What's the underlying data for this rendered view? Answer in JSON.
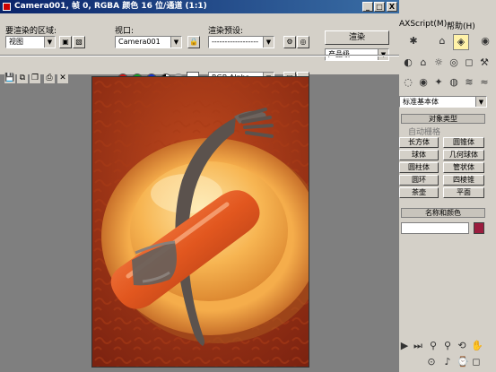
{
  "window": {
    "title": "Camera001, 帧 0, RGBA 颜色 16 位/通道 (1:1)",
    "minimize": "_",
    "maximize": "□",
    "close": "X"
  },
  "controls": {
    "area_label": "要渲染的区域:",
    "area_value": "视图",
    "viewport_label": "视口:",
    "viewport_value": "Camera001",
    "preset_label": "渲染预设:",
    "preset_value": "------------------",
    "render_button": "渲染",
    "quality_value": "产品级",
    "channel_value": "RGB Alpha",
    "dropdown_arrow": "▼"
  },
  "menu": {
    "maxscript": "AXScript(M)",
    "help": "帮助(H)"
  },
  "command_panel": {
    "category": "标准基本体",
    "rollout_title": "对象类型",
    "autogrid": "自动栅格",
    "buttons": [
      "长方体",
      "圆锥体",
      "球体",
      "几何球体",
      "圆柱体",
      "管状体",
      "圆环",
      "四棱锥",
      "茶壶",
      "平面"
    ],
    "name_color_title": "名称和颜色",
    "object_color": "#9b1c3e"
  },
  "colors": {
    "background": "#7f7f7f",
    "plate": "#f6b050",
    "sausage": "#e05a24",
    "backdrop": "#a63316"
  }
}
